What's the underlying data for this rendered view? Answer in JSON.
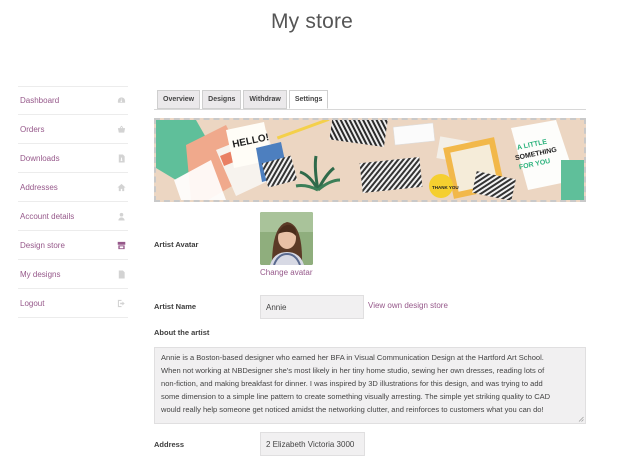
{
  "page": {
    "title": "My store"
  },
  "sidebar": {
    "items": [
      {
        "label": "Dashboard",
        "icon": "dashboard-icon"
      },
      {
        "label": "Orders",
        "icon": "basket-icon"
      },
      {
        "label": "Downloads",
        "icon": "file-download-icon"
      },
      {
        "label": "Addresses",
        "icon": "home-icon"
      },
      {
        "label": "Account details",
        "icon": "user-icon"
      },
      {
        "label": "Design store",
        "icon": "store-icon",
        "active": true
      },
      {
        "label": "My designs",
        "icon": "file-icon"
      },
      {
        "label": "Logout",
        "icon": "logout-icon"
      }
    ]
  },
  "tabs": [
    {
      "label": "Overview"
    },
    {
      "label": "Designs"
    },
    {
      "label": "Withdraw"
    },
    {
      "label": "Settings",
      "active": true
    }
  ],
  "banner": {
    "card_hello": "HELLO!",
    "card_text_1": "A LITTLE",
    "card_text_2": "SOMETHING",
    "card_text_3": "FOR YOU",
    "thank_you": "THANK YOU"
  },
  "form": {
    "avatar_label": "Artist Avatar",
    "change_avatar": "Change avatar",
    "name_label": "Artist Name",
    "name_value": "Annie",
    "view_store_link": "View own design store",
    "about_label": "About the artist",
    "about_lines": [
      "Annie is a Boston-based designer who earned her BFA in Visual Communication Design at the Hartford Art School.",
      "When not working at NBDesigner she's most likely in her tiny home studio, sewing her own dresses, reading lots of",
      "non-fiction, and making breakfast for dinner. I was inspired by 3D illustrations for this design, and was trying to add",
      "some dimension to a simple line pattern to create something visually arresting. The simple yet striking quality to CAD",
      "would really help someone get noticed amidst the networking clutter, and reinforces to customers what you can do!"
    ],
    "address_label": "Address",
    "address_value": "2 Elizabeth Victoria 3000"
  },
  "colors": {
    "accent": "#96588a",
    "field_bg": "#f1f0f1",
    "tab_bg": "#ebe9eb"
  }
}
